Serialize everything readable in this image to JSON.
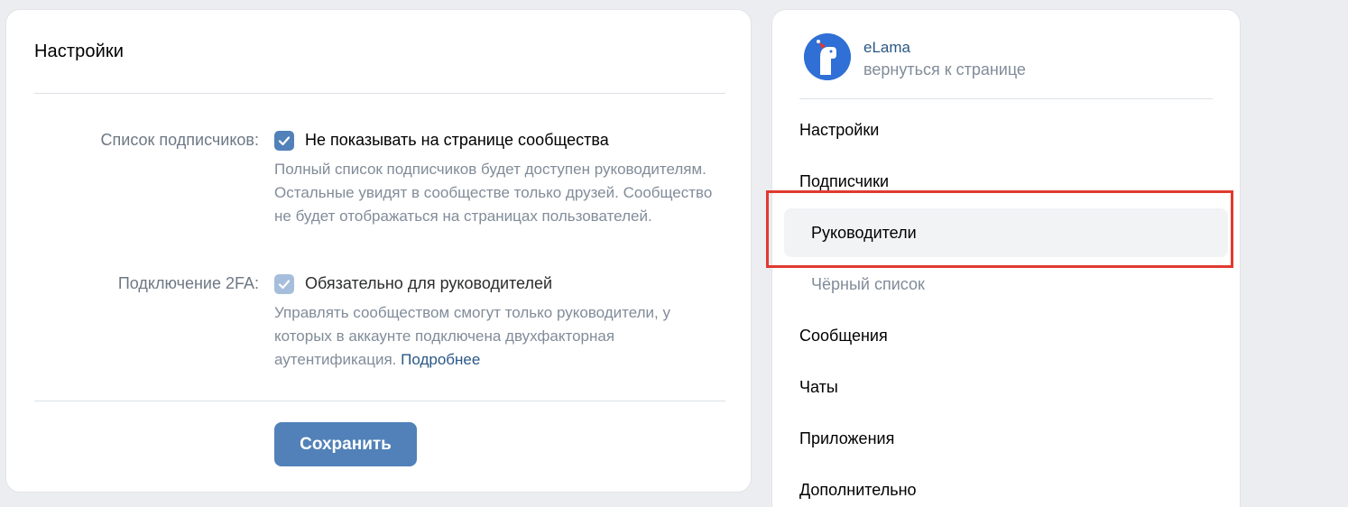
{
  "main": {
    "title": "Настройки",
    "subscribers": {
      "label": "Список подписчиков:",
      "option": "Не показывать на странице сообщества",
      "checked": true,
      "description": "Полный список подписчиков будет доступен руководителям. Остальные увидят в сообществе только друзей. Сообщество не будет отображаться на страницах пользователей."
    },
    "twofa": {
      "label": "Подключение 2FA:",
      "option": "Обязательно для руководителей",
      "checked": true,
      "description": "Управлять сообществом смогут только руководители, у которых в аккаунте подключена двухфакторная аутентификация.",
      "link": "Подробнее"
    },
    "save_label": "Сохранить"
  },
  "side": {
    "community_name": "eLama",
    "back_link": "вернуться к странице",
    "nav": [
      {
        "label": "Настройки"
      },
      {
        "label": "Подписчики"
      },
      {
        "label": "Руководители",
        "active": true
      },
      {
        "label": "Чёрный список"
      },
      {
        "label": "Сообщения"
      },
      {
        "label": "Чаты"
      },
      {
        "label": "Приложения"
      },
      {
        "label": "Дополнительно"
      }
    ]
  },
  "colors": {
    "accent": "#5181b8",
    "link": "#2a5885",
    "highlight": "#e03a2f",
    "muted_text": "#818c99"
  }
}
